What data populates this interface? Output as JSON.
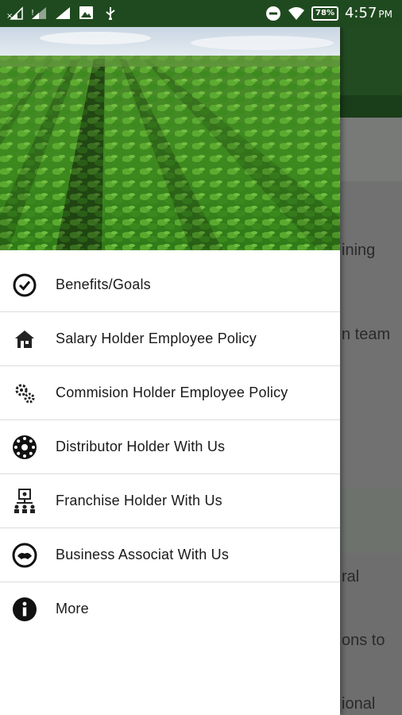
{
  "status_bar": {
    "time": "4:57",
    "ampm": "PM",
    "battery": "78%"
  },
  "background_text": [
    "ining",
    "n team",
    "ral",
    "ons to",
    "ional"
  ],
  "drawer": {
    "items": [
      {
        "label": "Benefits/Goals",
        "icon": "check-circle-icon"
      },
      {
        "label": "Salary Holder Employee Policy",
        "icon": "house-icon"
      },
      {
        "label": "Commision Holder Employee Policy",
        "icon": "gears-icon"
      },
      {
        "label": "Distributor Holder With Us",
        "icon": "distributor-wheel-icon"
      },
      {
        "label": "Franchise Holder With Us",
        "icon": "franchise-network-icon"
      },
      {
        "label": "Business Associat With Us",
        "icon": "handshake-icon"
      },
      {
        "label": "More",
        "icon": "info-icon"
      }
    ]
  }
}
